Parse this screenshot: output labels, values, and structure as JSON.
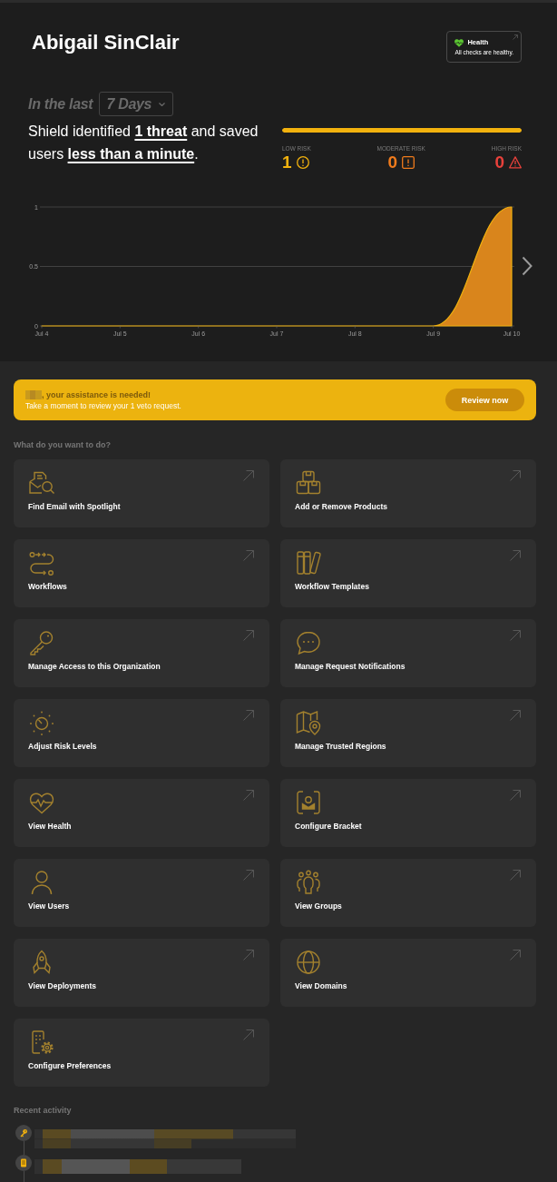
{
  "header": {
    "name": "Abigail SinClair",
    "health": {
      "title": "Health",
      "status": "All checks are healthy.",
      "healthy": true
    }
  },
  "summary": {
    "period_label": "In the last",
    "period": "7 Days",
    "text": "Shield identified **1 threat** and saved users **less than a minute**.",
    "risk_bar": {
      "level": 1
    },
    "risk_levels": [
      {
        "kind": "low",
        "label": "LOW RISK",
        "count": "1",
        "color": "#f2b20e"
      },
      {
        "kind": "moderate",
        "label": "MODERATE RISK",
        "count": "0",
        "color": "#f07b1c"
      },
      {
        "kind": "high",
        "label": "HIGH RISK",
        "count": "0",
        "color": "#e8413b"
      }
    ]
  },
  "chart": {
    "chart_data": {
      "type": "area",
      "categories": [
        "Jul 4",
        "Jul 5",
        "Jul 6",
        "Jul 7",
        "Jul 8",
        "Jul 9",
        "Jul 10"
      ],
      "series": [
        {
          "color": "#d9851c",
          "values": [
            0,
            0,
            0,
            0,
            0,
            0,
            1
          ]
        }
      ],
      "ylim": [
        0,
        1
      ],
      "yticks": [
        0,
        0.5,
        1
      ]
    }
  },
  "banner": {
    "title": ", your assistance is needed!",
    "message": "Take a moment to review your 1 veto request.",
    "button": "Review now"
  },
  "actions": {
    "title": "What do you want to do?",
    "items": [
      {
        "label": "Find Email with Spotlight"
      },
      {
        "label": "Add or Remove Products"
      },
      {
        "label": "Workflows"
      },
      {
        "label": "Workflow Templates"
      },
      {
        "label": "Manage Access to this Organization"
      },
      {
        "label": "Manage Request Notifications"
      },
      {
        "label": "Adjust Risk Levels"
      },
      {
        "label": "Manage Trusted Regions"
      },
      {
        "label": "View Health"
      },
      {
        "label": "Configure Bracket"
      },
      {
        "label": "View Users"
      },
      {
        "label": "View Groups"
      },
      {
        "label": "View Deployments"
      },
      {
        "label": "View Domains"
      },
      {
        "label": "Configure Preferences"
      }
    ]
  },
  "recent_activity": {
    "title": "Recent activity",
    "items": [
      {
        "kind": "key"
      },
      {
        "kind": "device"
      }
    ]
  }
}
